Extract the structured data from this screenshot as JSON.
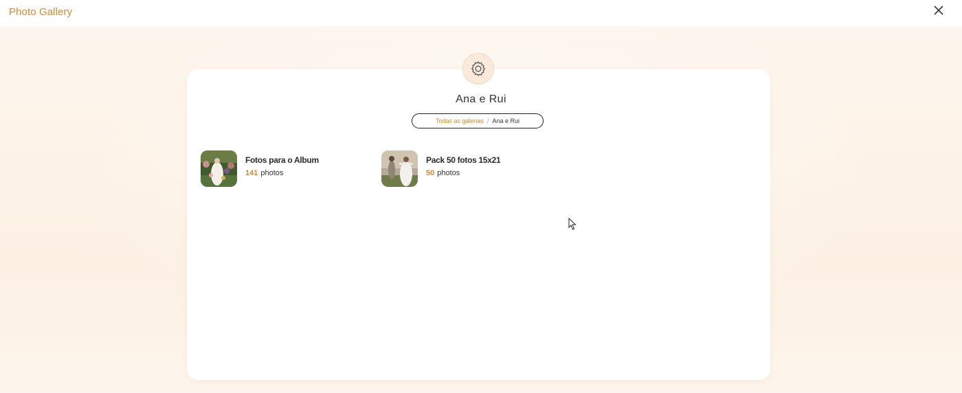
{
  "app": {
    "title": "Photo Gallery"
  },
  "gallery": {
    "title": "Ana e Rui",
    "breadcrumb": {
      "root": "Todas as galerias",
      "separator": "/",
      "current": "Ana e Rui"
    }
  },
  "albums": [
    {
      "name": "Fotos para o Album",
      "count": "141",
      "unit": "photos"
    },
    {
      "name": "Pack 50 fotos 15x21",
      "count": "50",
      "unit": "photos"
    }
  ],
  "colors": {
    "accent": "#d08a33",
    "backdrop": "#fdf3e9",
    "panel": "#ffffff"
  },
  "icons": {
    "close": "close-icon",
    "settings": "gear-icon"
  }
}
